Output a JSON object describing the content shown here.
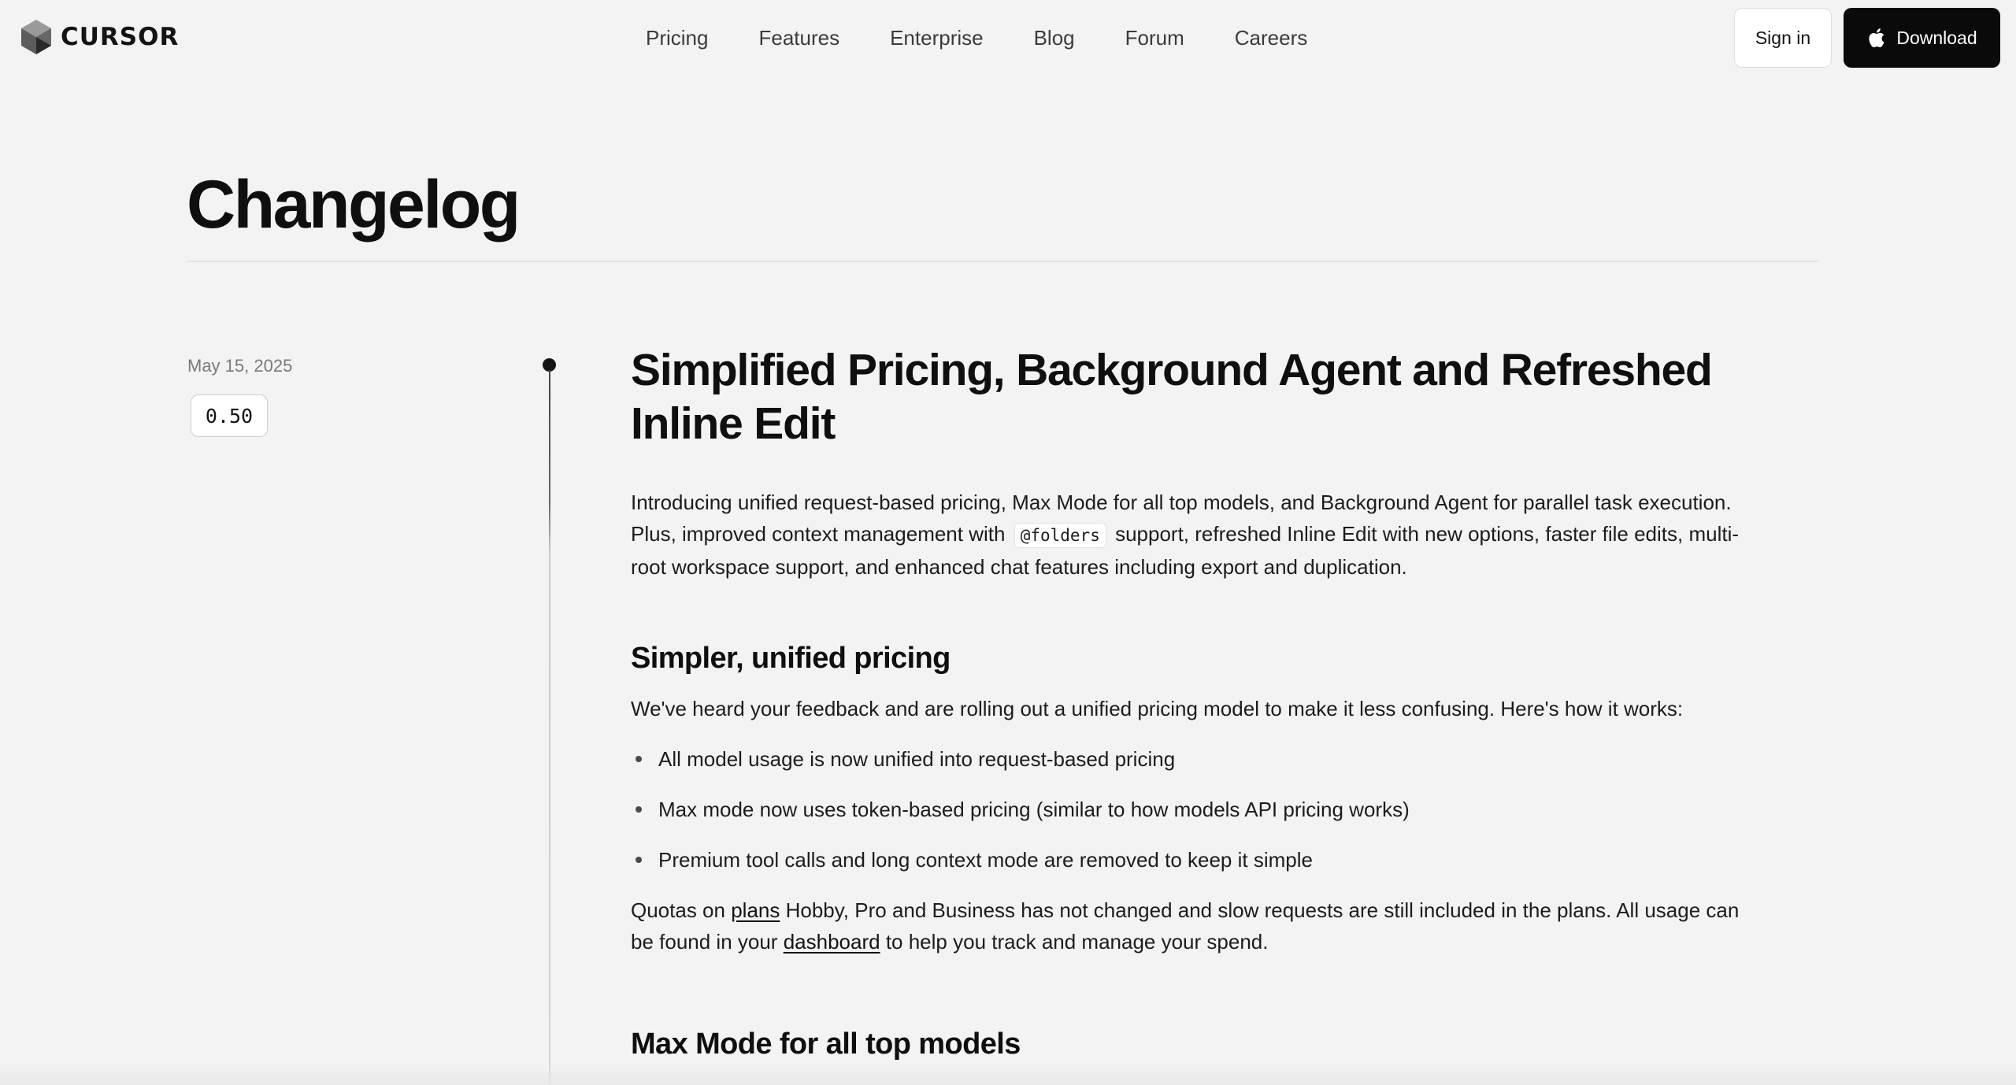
{
  "brand": {
    "name": "CURSOR"
  },
  "nav": {
    "items": [
      {
        "label": "Pricing"
      },
      {
        "label": "Features"
      },
      {
        "label": "Enterprise"
      },
      {
        "label": "Blog"
      },
      {
        "label": "Forum"
      },
      {
        "label": "Careers"
      }
    ]
  },
  "actions": {
    "sign_in": "Sign in",
    "download": "Download"
  },
  "page": {
    "title": "Changelog"
  },
  "entry": {
    "date": "May 15, 2025",
    "version": "0.50",
    "title": "Simplified Pricing, Background Agent and Refreshed Inline Edit",
    "intro": {
      "part1": "Introducing unified request-based pricing, Max Mode for all top models, and Background Agent for parallel task execution. Plus, improved context management with",
      "code": "@folders",
      "part2": "support, refreshed Inline Edit with new options, faster file edits, multi-root workspace support, and enhanced chat features including export and duplication."
    },
    "sections": [
      {
        "heading": "Simpler, unified pricing",
        "body": "We've heard your feedback and are rolling out a unified pricing model to make it less confusing. Here's how it works:",
        "bullets": [
          "All model usage is now unified into request-based pricing",
          "Max mode now uses token-based pricing (similar to how models API pricing works)",
          "Premium tool calls and long context mode are removed to keep it simple"
        ],
        "footer": {
          "pre": "Quotas on ",
          "link1": "plans",
          "mid": " Hobby, Pro and Business has not changed and slow requests are still included in the plans. All usage can be found in your ",
          "link2": "dashboard",
          "post": " to help you track and manage your spend."
        }
      },
      {
        "heading": "Max Mode for all top models"
      }
    ]
  },
  "colors": {
    "background": "#f3f3f3",
    "text": "#141414",
    "button_dark": "#0a0a0a"
  }
}
